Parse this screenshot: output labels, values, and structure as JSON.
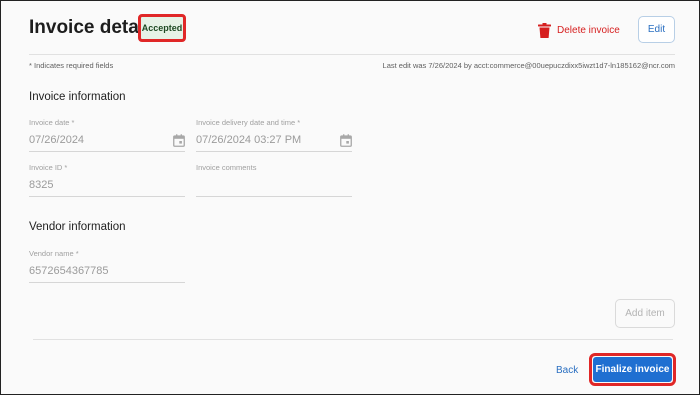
{
  "header": {
    "title": "Invoice details",
    "status": "Accepted",
    "delete_label": "Delete invoice",
    "edit_label": "Edit"
  },
  "meta": {
    "required_note": "* Indicates required fields",
    "last_edit": "Last edit was 7/26/2024 by acct:commerce@00uepuczdixx5iwzt1d7-ln185162@ncr.com"
  },
  "invoice_info": {
    "section_title": "Invoice information",
    "invoice_date_label": "Invoice date *",
    "invoice_date_value": "07/26/2024",
    "delivery_label": "Invoice delivery date and time *",
    "delivery_value": "07/26/2024 03:27 PM",
    "invoice_id_label": "Invoice ID *",
    "invoice_id_value": "8325",
    "comments_label": "Invoice comments",
    "comments_value": ""
  },
  "vendor_info": {
    "section_title": "Vendor information",
    "vendor_name_label": "Vendor name *",
    "vendor_name_value": "6572654367785"
  },
  "actions": {
    "add_item_label": "Add item",
    "back_label": "Back",
    "finalize_label": "Finalize invoice"
  },
  "colors": {
    "accent": "#1f6fd1",
    "danger": "#d61f1f",
    "highlight": "#e02727",
    "badge_bg": "#e6f2e6"
  },
  "icons": {
    "delete": "trash-icon",
    "date": "calendar-icon"
  }
}
